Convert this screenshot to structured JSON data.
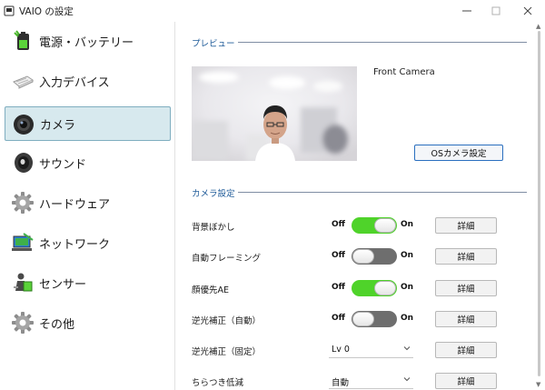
{
  "window": {
    "title": "VAIO の設定"
  },
  "sidebar": {
    "items": [
      {
        "label": "電源・バッテリー",
        "icon": "battery-icon"
      },
      {
        "label": "入力デバイス",
        "icon": "keyboard-icon"
      },
      {
        "label": "カメラ",
        "icon": "camera-icon",
        "active": true
      },
      {
        "label": "サウンド",
        "icon": "speaker-icon"
      },
      {
        "label": "ハードウェア",
        "icon": "gear-icon"
      },
      {
        "label": "ネットワーク",
        "icon": "network-icon"
      },
      {
        "label": "センサー",
        "icon": "sensor-icon"
      },
      {
        "label": "その他",
        "icon": "gear-icon"
      }
    ]
  },
  "preview": {
    "section_title": "プレビュー",
    "camera_name": "Front Camera",
    "os_settings_button": "OSカメラ設定"
  },
  "camera_settings": {
    "section_title": "カメラ設定",
    "rows": [
      {
        "label": "背景ぼかし",
        "type": "toggle",
        "state": "on",
        "detail": "詳細"
      },
      {
        "label": "自動フレーミング",
        "type": "toggle",
        "state": "off",
        "detail": "詳細"
      },
      {
        "label": "顔優先AE",
        "type": "toggle",
        "state": "on",
        "detail": "詳細"
      },
      {
        "label": "逆光補正（自動）",
        "type": "toggle",
        "state": "off",
        "detail": "詳細"
      },
      {
        "label": "逆光補正（固定）",
        "type": "select",
        "value": "Lv 0",
        "detail": "詳細"
      },
      {
        "label": "ちらつき低減",
        "type": "select",
        "value": "自動",
        "detail": "詳細"
      }
    ],
    "toggle_off_label": "Off",
    "toggle_on_label": "On"
  },
  "colors": {
    "toggle_on": "#4fd32a",
    "toggle_off": "#6e6e6e",
    "active_nav": "#d7e9ee",
    "section_title": "#1f5b99"
  }
}
